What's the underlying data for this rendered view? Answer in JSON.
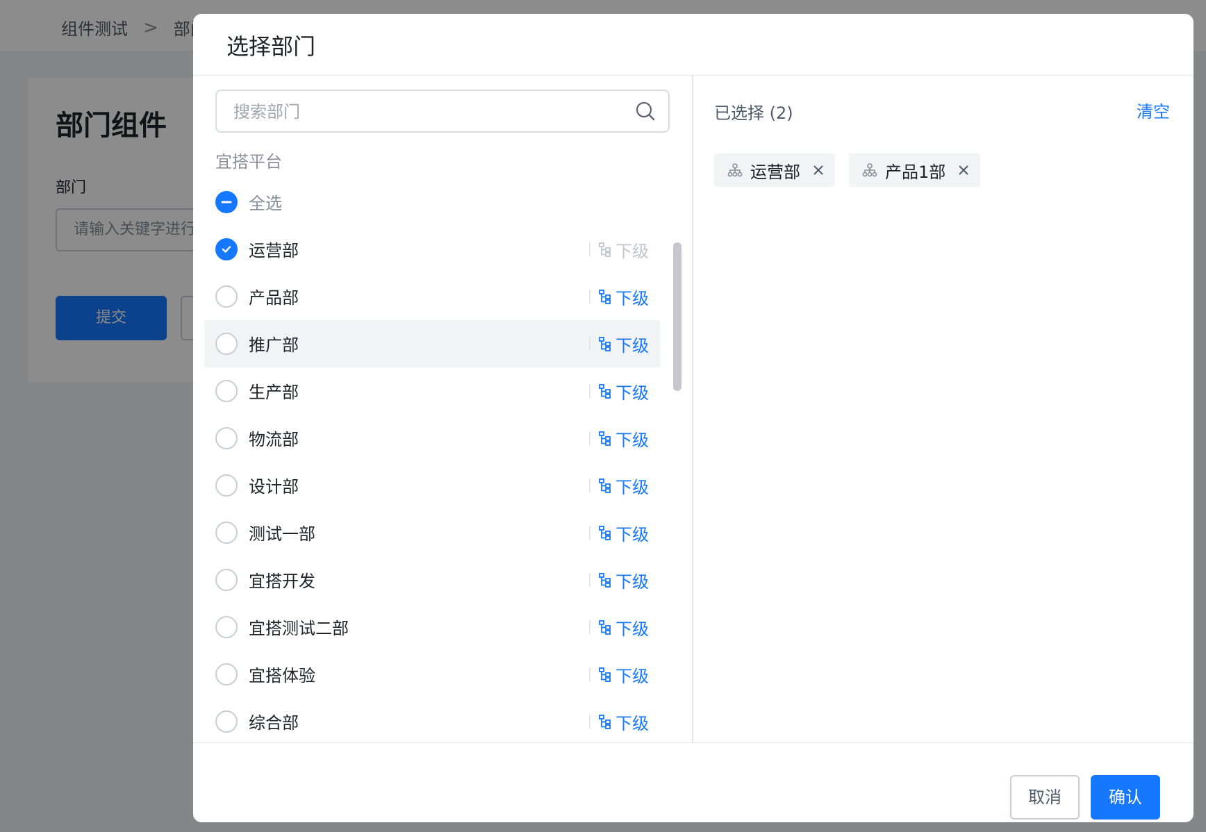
{
  "page": {
    "breadcrumb": {
      "root": "组件测试",
      "separator": ">",
      "current": "部门"
    },
    "title": "部门组件",
    "field_label": "部门",
    "field_placeholder": "请输入关键字进行",
    "submit_label": "提交"
  },
  "modal": {
    "title": "选择部门",
    "search_placeholder": "搜索部门",
    "org_name": "宜搭平台",
    "select_all_label": "全选",
    "sub_label": "下级",
    "departments": [
      {
        "name": "运营部",
        "checked": true,
        "sub_enabled": false
      },
      {
        "name": "产品部",
        "checked": false,
        "sub_enabled": true
      },
      {
        "name": "推广部",
        "checked": false,
        "sub_enabled": true
      },
      {
        "name": "生产部",
        "checked": false,
        "sub_enabled": true
      },
      {
        "name": "物流部",
        "checked": false,
        "sub_enabled": true
      },
      {
        "name": "设计部",
        "checked": false,
        "sub_enabled": true
      },
      {
        "name": "测试一部",
        "checked": false,
        "sub_enabled": true
      },
      {
        "name": "宜搭开发",
        "checked": false,
        "sub_enabled": true
      },
      {
        "name": "宜搭测试二部",
        "checked": false,
        "sub_enabled": true
      },
      {
        "name": "宜搭体验",
        "checked": false,
        "sub_enabled": true
      },
      {
        "name": "综合部",
        "checked": false,
        "sub_enabled": true
      }
    ],
    "selected_title": "已选择 (2)",
    "clear_label": "清空",
    "selected_tags": [
      "运营部",
      "产品1部"
    ],
    "cancel_label": "取消",
    "confirm_label": "确认"
  },
  "colors": {
    "accent": "#1677ff",
    "border": "#c9cdd4",
    "hover_row": "#f2f3f5",
    "muted_text": "#86909c"
  }
}
